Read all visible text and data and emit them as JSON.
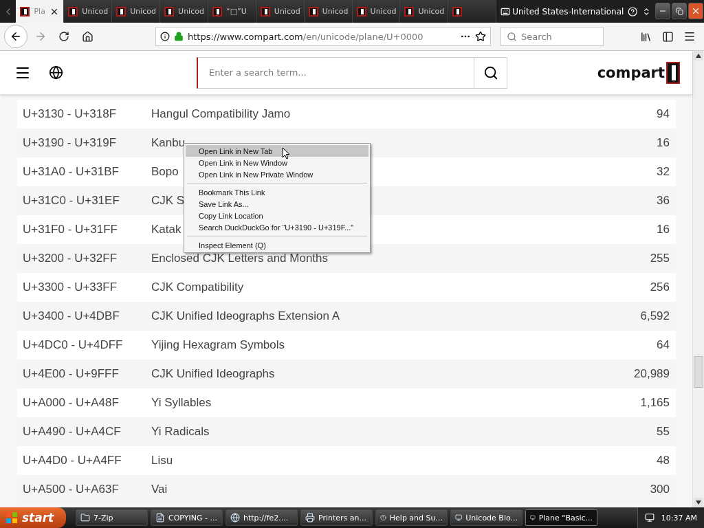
{
  "tabs": [
    {
      "label": "Pla",
      "selected": true
    },
    {
      "label": "Unicod",
      "selected": false
    },
    {
      "label": "Unicod",
      "selected": false
    },
    {
      "label": "Unicod",
      "selected": false
    },
    {
      "label": "“□”U",
      "selected": false
    },
    {
      "label": "Unicod",
      "selected": false
    },
    {
      "label": "Unicod",
      "selected": false
    },
    {
      "label": "Unicod",
      "selected": false
    },
    {
      "label": "Unicod",
      "selected": false
    },
    {
      "selected": false
    }
  ],
  "keyboard_layout": "United States-International",
  "toolbar": {
    "url_host": "https://www.compart.com",
    "url_path": "/en/unicode/plane/U+0000",
    "search_placeholder": "Search"
  },
  "site": {
    "search_placeholder": "Enter a search term...",
    "logo": "compart"
  },
  "rows": [
    {
      "range": "U+3130 - U+318F",
      "name": "Hangul Compatibility Jamo",
      "count": "94"
    },
    {
      "range": "U+3190 - U+319F",
      "name": "Kanbu",
      "count": "16"
    },
    {
      "range": "U+31A0 - U+31BF",
      "name": "Bopo",
      "count": "32"
    },
    {
      "range": "U+31C0 - U+31EF",
      "name": "CJK S",
      "count": "36"
    },
    {
      "range": "U+31F0 - U+31FF",
      "name": "Katak",
      "count": "16"
    },
    {
      "range": "U+3200 - U+32FF",
      "name": "Enclosed CJK Letters and Months",
      "count": "255"
    },
    {
      "range": "U+3300 - U+33FF",
      "name": "CJK Compatibility",
      "count": "256"
    },
    {
      "range": "U+3400 - U+4DBF",
      "name": "CJK Unified Ideographs Extension A",
      "count": "6,592"
    },
    {
      "range": "U+4DC0 - U+4DFF",
      "name": "Yijing Hexagram Symbols",
      "count": "64"
    },
    {
      "range": "U+4E00 - U+9FFF",
      "name": "CJK Unified Ideographs",
      "count": "20,989"
    },
    {
      "range": "U+A000 - U+A48F",
      "name": "Yi Syllables",
      "count": "1,165"
    },
    {
      "range": "U+A490 - U+A4CF",
      "name": "Yi Radicals",
      "count": "55"
    },
    {
      "range": "U+A4D0 - U+A4FF",
      "name": "Lisu",
      "count": "48"
    },
    {
      "range": "U+A500 - U+A63F",
      "name": "Vai",
      "count": "300"
    }
  ],
  "context_menu": {
    "groups": [
      [
        {
          "label": "Open Link in New Tab",
          "selected": true
        },
        {
          "label": "Open Link in New Window",
          "selected": false
        },
        {
          "label": "Open Link in New Private Window",
          "selected": false
        }
      ],
      [
        {
          "label": "Bookmark This Link",
          "selected": false
        },
        {
          "label": "Save Link As...",
          "selected": false
        },
        {
          "label": "Copy Link Location",
          "selected": false
        },
        {
          "label": "Search DuckDuckGo for “U+3190 - U+319F...”",
          "selected": false
        }
      ],
      [
        {
          "label": "Inspect Element (Q)",
          "selected": false
        }
      ]
    ]
  },
  "taskbar": {
    "start": "start",
    "items": [
      {
        "label": "7-Zip",
        "selected": false
      },
      {
        "label": "COPYING - ...",
        "selected": false
      },
      {
        "label": "http://fe2....",
        "selected": false
      },
      {
        "label": "Printers an...",
        "selected": false
      },
      {
        "label": "Help and Su...",
        "selected": false
      },
      {
        "label": "Unicode Blo...",
        "selected": false
      },
      {
        "label": "Plane \"Basic...",
        "selected": true
      }
    ],
    "clock": "10:37 AM"
  }
}
